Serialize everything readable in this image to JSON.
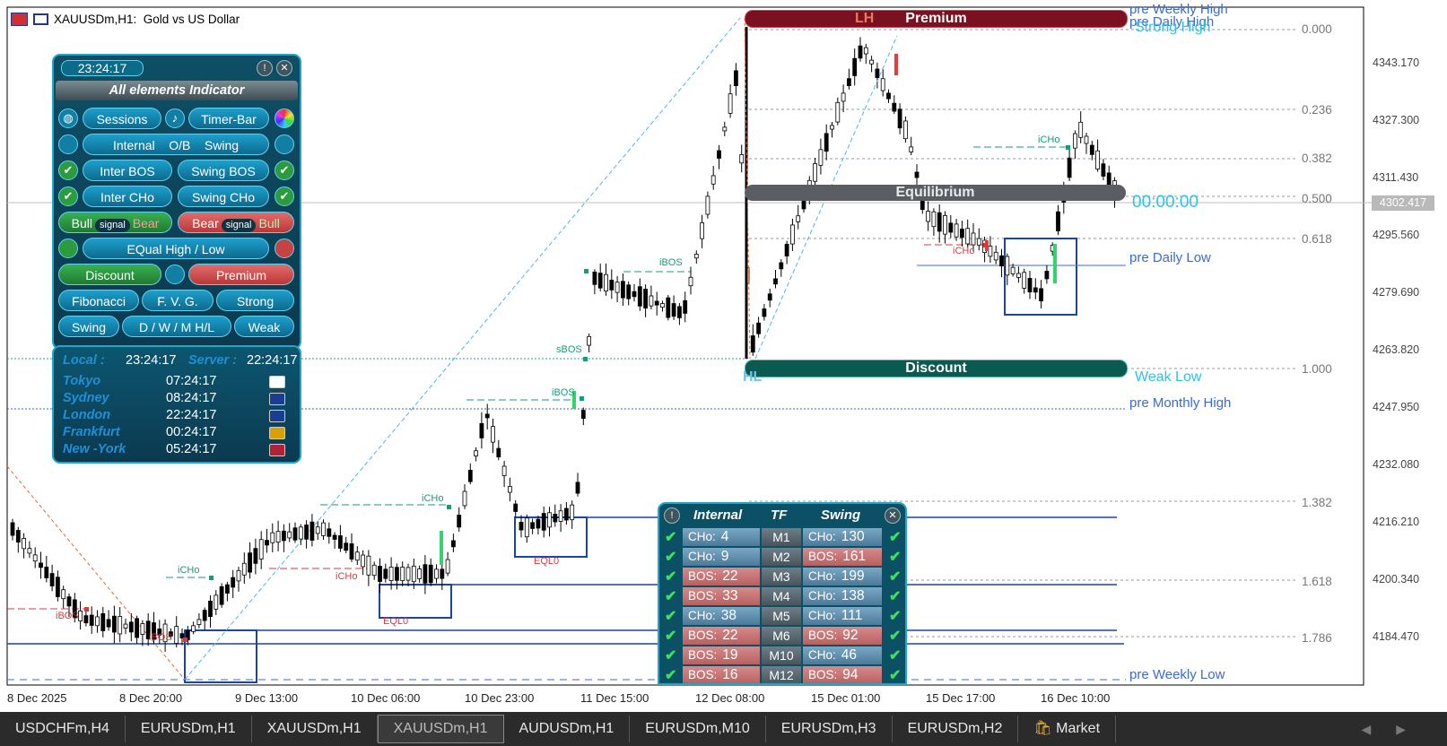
{
  "window": {
    "symbol": "XAUUSDm",
    "timeframe_title": ",H1:",
    "description": "Gold vs US Dollar"
  },
  "price_axis": {
    "labels": [
      "4343.170",
      "4327.300",
      "4311.430",
      "4295.560",
      "4279.690",
      "4263.820",
      "4247.950",
      "4232.080",
      "4216.210",
      "4200.340",
      "4184.470"
    ],
    "current": "4302.417"
  },
  "time_axis": [
    "8 Dec 2025",
    "8 Dec 20:00",
    "9 Dec 13:00",
    "10 Dec 06:00",
    "10 Dec 23:00",
    "11 Dec 15:00",
    "12 Dec 08:00",
    "15 Dec 01:00",
    "15 Dec 17:00",
    "16 Dec 10:00"
  ],
  "fib_levels": [
    "0.000",
    "0.236",
    "0.382",
    "0.500",
    "0.618",
    "1.000",
    "1.382",
    "1.618",
    "1.786"
  ],
  "chart_labels": {
    "premium": "Premium",
    "equilibrium": "Equilibrium",
    "discount": "Discount",
    "lh": "LH",
    "hl": "HL",
    "pre_weekly_high": "pre Weekly High",
    "pre_daily_high": "pre Daily High",
    "strong_high": "Strong High",
    "pre_daily_low": "pre Daily Low",
    "weak_low": "Weak Low",
    "pre_monthly_high": "pre Monthly High",
    "pre_weekly_low": "pre Weekly Low",
    "timer": "00:00:00",
    "ibos": "iBOS",
    "icho": "iCHo",
    "sbos": "sBOS",
    "eqlo": "EQL0"
  },
  "panel": {
    "clock": "23:24:17",
    "title": "All  elements  Indicator",
    "info_icon": "!",
    "close_icon": "✕",
    "sessions": "Sessions",
    "timer_bar": "Timer-Bar",
    "internal": "Internal",
    "ob": "O/B",
    "swing": "Swing",
    "inter_bos": "Inter BOS",
    "swing_bos": "Swing BOS",
    "inter_cho": "Inter CHo",
    "swing_cho": "Swing CHo",
    "bull1": "Bull",
    "signal1": "signal",
    "bear1": "Bear",
    "bear2": "Bear",
    "signal2": "signal",
    "bull2": "Bull",
    "equal": "EQual  High / Low",
    "discount": "Discount",
    "premium": "Premium",
    "fibonacci": "Fibonacci",
    "fvg": "F. V. G.",
    "strong": "Strong",
    "swing2": "Swing",
    "dwm": "D / W / M   H/L",
    "weak": "Weak"
  },
  "sessions_panel": {
    "local_label": "Local :",
    "local_time": "23:24:17",
    "server_label": "Server :",
    "server_time": "22:24:17",
    "cities": [
      {
        "name": "Tokyo",
        "time": "07:24:17",
        "flag_color": "#ffffff"
      },
      {
        "name": "Sydney",
        "time": "08:24:17",
        "flag_color": "#1a3d8f"
      },
      {
        "name": "London",
        "time": "22:24:17",
        "flag_color": "#1a3d8f"
      },
      {
        "name": "Frankfurt",
        "time": "00:24:17",
        "flag_color": "#d8a000"
      },
      {
        "name": "New -York",
        "time": "05:24:17",
        "flag_color": "#b22234"
      }
    ]
  },
  "tf_table": {
    "header_internal": "Internal",
    "header_tf": "TF",
    "header_swing": "Swing",
    "info_icon": "!",
    "close_icon": "✕",
    "rows": [
      {
        "internal_type": "CHo:",
        "internal_value": "4",
        "tf": "M1",
        "swing_type": "CHo:",
        "swing_value": "130"
      },
      {
        "internal_type": "CHo:",
        "internal_value": "9",
        "tf": "M2",
        "swing_type": "BOS:",
        "swing_value": "161"
      },
      {
        "internal_type": "BOS:",
        "internal_value": "22",
        "tf": "M3",
        "swing_type": "CHo:",
        "swing_value": "199"
      },
      {
        "internal_type": "BOS:",
        "internal_value": "33",
        "tf": "M4",
        "swing_type": "CHo:",
        "swing_value": "138"
      },
      {
        "internal_type": "CHo:",
        "internal_value": "38",
        "tf": "M5",
        "swing_type": "CHo:",
        "swing_value": "111"
      },
      {
        "internal_type": "BOS:",
        "internal_value": "22",
        "tf": "M6",
        "swing_type": "BOS:",
        "swing_value": "92"
      },
      {
        "internal_type": "BOS:",
        "internal_value": "19",
        "tf": "M10",
        "swing_type": "CHo:",
        "swing_value": "46"
      },
      {
        "internal_type": "BOS:",
        "internal_value": "16",
        "tf": "M12",
        "swing_type": "BOS:",
        "swing_value": "94"
      }
    ]
  },
  "tabs": [
    {
      "label": "USDCHFm,H4",
      "active": false
    },
    {
      "label": "EURUSDm,H1",
      "active": false
    },
    {
      "label": "XAUUSDm,H1",
      "active": false
    },
    {
      "label": "XAUUSDm,H1",
      "active": true
    },
    {
      "label": "AUDUSDm,H1",
      "active": false
    },
    {
      "label": "EURUSDm,M10",
      "active": false
    },
    {
      "label": "EURUSDm,H3",
      "active": false
    },
    {
      "label": "EURUSDm,H2",
      "active": false
    },
    {
      "label": "Market",
      "active": false
    }
  ],
  "tab_nav": [
    "◀",
    "▶"
  ],
  "colors": {
    "bull_candle": "#ffffff",
    "bear_candle": "#000000",
    "premium_zone": "#7a1020",
    "discount_zone": "#0b5a50",
    "equilibrium_zone": "#5a5e62",
    "accent_cyan": "#2ec2e8",
    "fib_line": "#999999"
  }
}
